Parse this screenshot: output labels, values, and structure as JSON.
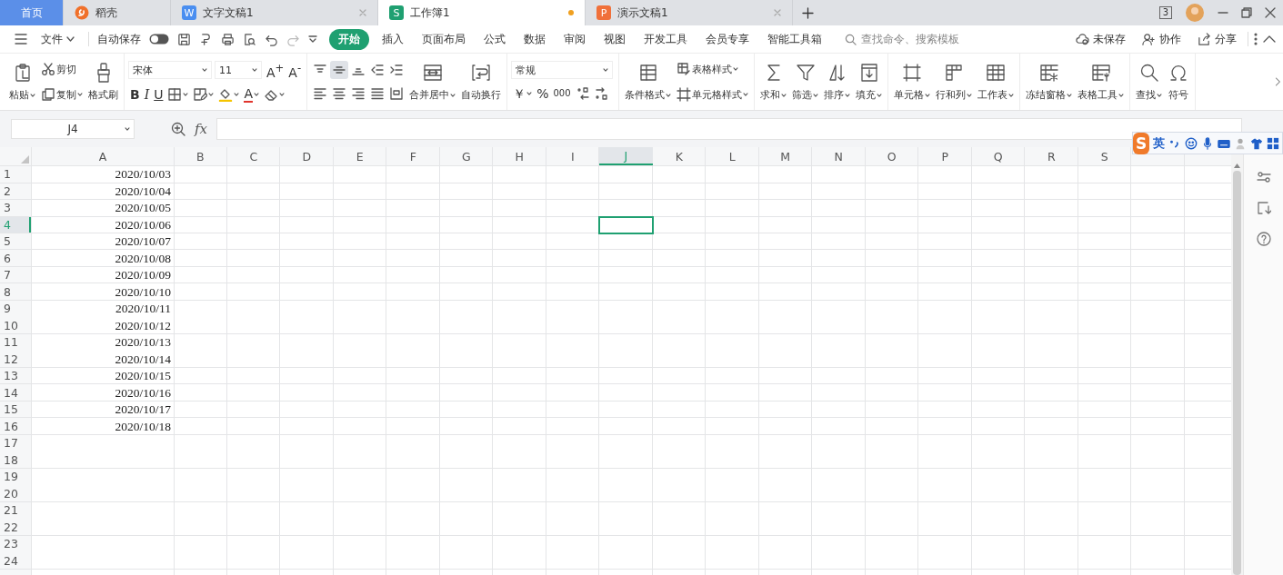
{
  "tabs_bar": {
    "tabs": [
      {
        "kind": "home",
        "label": "首页",
        "selected": false
      },
      {
        "kind": "docer",
        "label": "稻壳",
        "selected": false
      },
      {
        "kind": "doc",
        "badge": "W",
        "color": "#4a8ef0",
        "label": "文字文稿1",
        "selected": false,
        "modified": false
      },
      {
        "kind": "doc",
        "badge": "S",
        "color": "#1fa071",
        "label": "工作簿1",
        "selected": true,
        "modified": true
      },
      {
        "kind": "doc",
        "badge": "P",
        "color": "#f0703a",
        "label": "演示文稿1",
        "selected": false,
        "modified": false
      }
    ],
    "window_count": "3"
  },
  "menu": {
    "file": "文件",
    "autosave": {
      "label": "自动保存",
      "on": false
    },
    "tabs": [
      {
        "label": "开始",
        "selected": true
      },
      {
        "label": "插入",
        "selected": false
      },
      {
        "label": "页面布局",
        "selected": false
      },
      {
        "label": "公式",
        "selected": false
      },
      {
        "label": "数据",
        "selected": false
      },
      {
        "label": "审阅",
        "selected": false
      },
      {
        "label": "视图",
        "selected": false
      },
      {
        "label": "开发工具",
        "selected": false
      },
      {
        "label": "会员专享",
        "selected": false
      },
      {
        "label": "智能工具箱",
        "selected": false
      }
    ],
    "search": {
      "placeholder": "查找命令、搜索模板"
    },
    "actions": [
      "未保存",
      "协作",
      "分享"
    ]
  },
  "ribbon": {
    "groups": [
      {
        "items": [
          {
            "kind": "big",
            "label": "粘贴",
            "dropdown": true
          },
          {
            "kind": "stack",
            "items": [
              {
                "label": "剪切",
                "dropdown": false
              },
              {
                "label": "复制",
                "dropdown": true
              }
            ]
          },
          {
            "kind": "big",
            "label": "格式刷",
            "dropdown": false
          }
        ]
      },
      {
        "items": [
          {
            "kind": "lines",
            "lines": [
              {
                "items": [
                  {
                    "kind": "field",
                    "value": "宋体",
                    "dropdown": true
                  },
                  {
                    "kind": "field",
                    "value": "11",
                    "dropdown": true
                  },
                  {
                    "kind": "text",
                    "label": "A$^{+}$",
                    "dropdown": false
                  },
                  {
                    "kind": "text",
                    "label": "A$^{-}$",
                    "dropdown": false
                  }
                ]
              },
              {
                "items": [
                  {
                    "kind": "text",
                    "label": "B",
                    "dropdown": false
                  },
                  {
                    "kind": "text",
                    "label": "I",
                    "dropdown": false
                  },
                  {
                    "kind": "text",
                    "label": "U",
                    "dropdown": false
                  },
                  {
                    "kind": "tool",
                    "dropdown": true
                  },
                  {
                    "kind": "tool",
                    "dropdown": true
                  },
                  {
                    "kind": "tool",
                    "dropdown": true
                  },
                  {
                    "kind": "text",
                    "label": "A",
                    "color": "#e0342c",
                    "dropdown": true
                  },
                  {
                    "kind": "tool",
                    "dropdown": true
                  }
                ]
              }
            ]
          }
        ]
      },
      {
        "items": [
          {
            "kind": "lines",
            "lines": [
              {
                "items": [
                  {
                    "kind": "tool",
                    "selected": false
                  },
                  {
                    "kind": "tool",
                    "selected": true
                  },
                  {
                    "kind": "tool",
                    "selected": false
                  },
                  {
                    "kind": "tool",
                    "selected": false
                  },
                  {
                    "kind": "tool",
                    "selected": false
                  }
                ]
              },
              {
                "items": [
                  {
                    "kind": "tool",
                    "selected": false
                  },
                  {
                    "kind": "tool",
                    "selected": false
                  },
                  {
                    "kind": "tool",
                    "selected": false
                  },
                  {
                    "kind": "tool",
                    "selected": false
                  },
                  {
                    "kind": "tool",
                    "selected": false
                  }
                ]
              }
            ]
          },
          {
            "kind": "big",
            "label": "合并居中",
            "dropdown": true
          },
          {
            "kind": "big",
            "label": "自动换行",
            "dropdown": false
          }
        ]
      },
      {
        "items": [
          {
            "kind": "lines",
            "lines": [
              {
                "items": [
                  {
                    "kind": "field",
                    "value": "常规",
                    "dropdown": true
                  }
                ]
              },
              {
                "items": [
                  {
                    "kind": "text",
                    "label": "￥",
                    "dropdown": true
                  },
                  {
                    "kind": "text",
                    "label": "%",
                    "dropdown": false
                  },
                  {
                    "kind": "text",
                    "label": "000",
                    "dropdown": false
                  },
                  {
                    "kind": "tool",
                    "dropdown": false
                  },
                  {
                    "kind": "tool",
                    "dropdown": false
                  }
                ]
              }
            ]
          }
        ]
      },
      {
        "items": [
          {
            "kind": "big",
            "label": "条件格式",
            "dropdown": true
          },
          {
            "kind": "stack",
            "items": [
              {
                "label": "表格样式",
                "dropdown": true
              },
              {
                "label": "单元格样式",
                "dropdown": true
              }
            ]
          }
        ]
      },
      {
        "items": [
          {
            "kind": "big",
            "label": "求和",
            "dropdown": true
          },
          {
            "kind": "big",
            "label": "筛选",
            "dropdown": true
          },
          {
            "kind": "big",
            "label": "排序",
            "dropdown": true
          },
          {
            "kind": "big",
            "label": "填充",
            "dropdown": true
          }
        ]
      },
      {
        "items": [
          {
            "kind": "big",
            "label": "单元格",
            "dropdown": true
          },
          {
            "kind": "big",
            "label": "行和列",
            "dropdown": true
          },
          {
            "kind": "big",
            "label": "工作表",
            "dropdown": true
          }
        ]
      },
      {
        "items": [
          {
            "kind": "big",
            "label": "冻结窗格",
            "dropdown": true
          },
          {
            "kind": "big",
            "label": "表格工具",
            "dropdown": true
          }
        ]
      },
      {
        "items": [
          {
            "kind": "big",
            "label": "查找",
            "dropdown": true
          },
          {
            "kind": "big",
            "label": "符号",
            "dropdown": false
          }
        ]
      }
    ]
  },
  "formula_bar": {
    "name_box": "J4",
    "fx": "fx"
  },
  "sheet": {
    "columns": [
      {
        "label": "A",
        "selected": false
      },
      {
        "label": "B",
        "selected": false
      },
      {
        "label": "C",
        "selected": false
      },
      {
        "label": "D",
        "selected": false
      },
      {
        "label": "E",
        "selected": false
      },
      {
        "label": "F",
        "selected": false
      },
      {
        "label": "G",
        "selected": false
      },
      {
        "label": "H",
        "selected": false
      },
      {
        "label": "I",
        "selected": false
      },
      {
        "label": "J",
        "selected": true
      },
      {
        "label": "K",
        "selected": false
      },
      {
        "label": "L",
        "selected": false
      },
      {
        "label": "M",
        "selected": false
      },
      {
        "label": "N",
        "selected": false
      },
      {
        "label": "O",
        "selected": false
      },
      {
        "label": "P",
        "selected": false
      },
      {
        "label": "Q",
        "selected": false
      },
      {
        "label": "R",
        "selected": false
      },
      {
        "label": "S",
        "selected": false
      }
    ],
    "rows": [
      {
        "number": "1",
        "selected": false,
        "cells": [
          "2020/10/03"
        ]
      },
      {
        "number": "2",
        "selected": false,
        "cells": [
          "2020/10/04"
        ]
      },
      {
        "number": "3",
        "selected": false,
        "cells": [
          "2020/10/05"
        ]
      },
      {
        "number": "4",
        "selected": true,
        "cells": [
          "2020/10/06"
        ]
      },
      {
        "number": "5",
        "selected": false,
        "cells": [
          "2020/10/07"
        ]
      },
      {
        "number": "6",
        "selected": false,
        "cells": [
          "2020/10/08"
        ]
      },
      {
        "number": "7",
        "selected": false,
        "cells": [
          "2020/10/09"
        ]
      },
      {
        "number": "8",
        "selected": false,
        "cells": [
          "2020/10/10"
        ]
      },
      {
        "number": "9",
        "selected": false,
        "cells": [
          "2020/10/11"
        ]
      },
      {
        "number": "10",
        "selected": false,
        "cells": [
          "2020/10/12"
        ]
      },
      {
        "number": "11",
        "selected": false,
        "cells": [
          "2020/10/13"
        ]
      },
      {
        "number": "12",
        "selected": false,
        "cells": [
          "2020/10/14"
        ]
      },
      {
        "number": "13",
        "selected": false,
        "cells": [
          "2020/10/15"
        ]
      },
      {
        "number": "14",
        "selected": false,
        "cells": [
          "2020/10/16"
        ]
      },
      {
        "number": "15",
        "selected": false,
        "cells": [
          "2020/10/17"
        ]
      },
      {
        "number": "16",
        "selected": false,
        "cells": [
          "2020/10/18"
        ]
      },
      {
        "number": "17",
        "selected": false,
        "cells": []
      },
      {
        "number": "18",
        "selected": false,
        "cells": []
      },
      {
        "number": "19",
        "selected": false,
        "cells": []
      },
      {
        "number": "20",
        "selected": false,
        "cells": []
      },
      {
        "number": "21",
        "selected": false,
        "cells": []
      },
      {
        "number": "22",
        "selected": false,
        "cells": []
      },
      {
        "number": "23",
        "selected": false,
        "cells": []
      },
      {
        "number": "24",
        "selected": false,
        "cells": []
      }
    ]
  },
  "ime": {
    "logo": "S",
    "mode": "英"
  }
}
